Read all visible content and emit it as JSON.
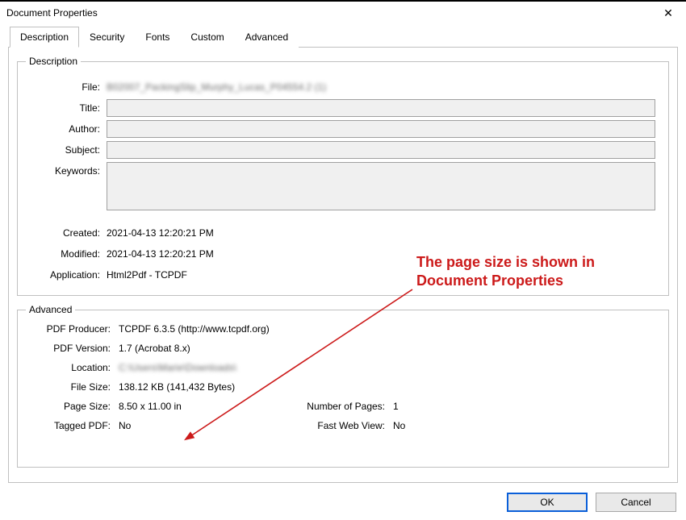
{
  "window": {
    "title": "Document Properties"
  },
  "tabs": {
    "t0": "Description",
    "t1": "Security",
    "t2": "Fonts",
    "t3": "Custom",
    "t4": "Advanced",
    "active": 0
  },
  "desc_group": {
    "legend": "Description",
    "labels": {
      "file": "File:",
      "title": "Title:",
      "author": "Author:",
      "subject": "Subject:",
      "keywords": "Keywords:",
      "created": "Created:",
      "modified": "Modified:",
      "application": "Application:"
    },
    "values": {
      "file": "B02007_PackingSlip_Murphy_Lucas_P04554.2 (1)",
      "title": "",
      "author": "",
      "subject": "",
      "keywords": "",
      "created": "2021-04-13 12:20:21 PM",
      "modified": "2021-04-13 12:20:21 PM",
      "application": "Html2Pdf - TCPDF"
    }
  },
  "adv_group": {
    "legend": "Advanced",
    "labels": {
      "producer": "PDF Producer:",
      "version": "PDF Version:",
      "location": "Location:",
      "filesize": "File Size:",
      "pagesize": "Page Size:",
      "pages": "Number of Pages:",
      "tagged": "Tagged PDF:",
      "fastweb": "Fast Web View:"
    },
    "values": {
      "producer": "TCPDF 6.3.5 (http://www.tcpdf.org)",
      "version": "1.7 (Acrobat 8.x)",
      "location": "C:\\Users\\Marie\\Downloads\\",
      "filesize": "138.12 KB (141,432 Bytes)",
      "pagesize": "8.50 x 11.00 in",
      "pages": "1",
      "tagged": "No",
      "fastweb": "No"
    }
  },
  "buttons": {
    "ok": "OK",
    "cancel": "Cancel"
  },
  "annotation": {
    "text": "The page size is shown in Document Properties"
  }
}
